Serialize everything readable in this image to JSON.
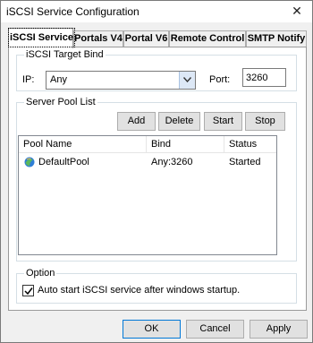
{
  "window": {
    "title": "iSCSI Service Configuration"
  },
  "tabs": [
    {
      "label": "iSCSI Service",
      "active": true
    },
    {
      "label": "Portals V4",
      "active": false
    },
    {
      "label": "Portal V6",
      "active": false
    },
    {
      "label": "Remote Control",
      "active": false
    },
    {
      "label": "SMTP Notify",
      "active": false
    }
  ],
  "target_bind": {
    "group_label": "iSCSI Target Bind",
    "ip_label": "IP:",
    "ip_value": "Any",
    "port_label": "Port:",
    "port_value": "3260"
  },
  "server_pool": {
    "group_label": "Server Pool List",
    "buttons": {
      "add": "Add",
      "delete": "Delete",
      "start": "Start",
      "stop": "Stop"
    },
    "columns": [
      "Pool Name",
      "Bind",
      "Status"
    ],
    "rows": [
      {
        "name": "DefaultPool",
        "bind": "Any:3260",
        "status": "Started"
      }
    ]
  },
  "option": {
    "group_label": "Option",
    "autostart_label": "Auto start iSCSI service after windows startup.",
    "autostart_checked": true
  },
  "footer": {
    "ok": "OK",
    "cancel": "Cancel",
    "apply": "Apply"
  }
}
